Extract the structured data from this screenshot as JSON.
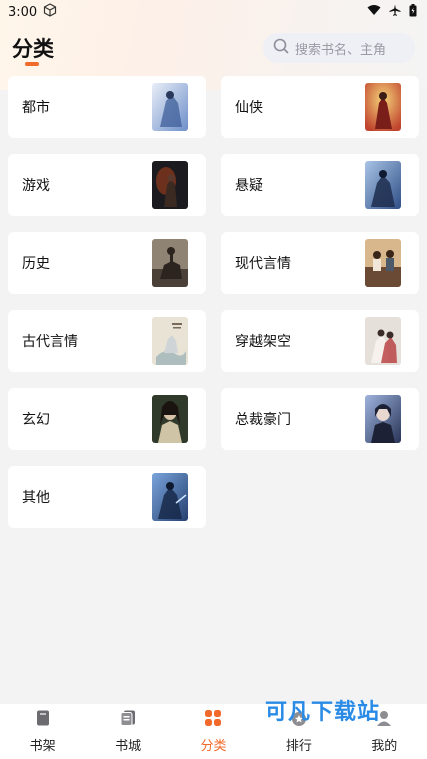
{
  "status_bar": {
    "time": "3:00"
  },
  "header": {
    "title": "分类",
    "search_placeholder": "搜索书名、主角"
  },
  "categories": [
    {
      "label": "都市",
      "thumb_colors": [
        "#6d8fc9",
        "#e9eef8"
      ]
    },
    {
      "label": "仙侠",
      "thumb_colors": [
        "#c0452e",
        "#e8b34a"
      ]
    },
    {
      "label": "游戏",
      "thumb_colors": [
        "#1b1b1f",
        "#b0421c"
      ]
    },
    {
      "label": "悬疑",
      "thumb_colors": [
        "#2f4f86",
        "#a9c4e6"
      ]
    },
    {
      "label": "历史",
      "thumb_colors": [
        "#4a4038",
        "#8f8373"
      ]
    },
    {
      "label": "现代言情",
      "thumb_colors": [
        "#6a4a34",
        "#d8b78d"
      ]
    },
    {
      "label": "古代言情",
      "thumb_colors": [
        "#e9e3d6",
        "#9fb3b8"
      ]
    },
    {
      "label": "穿越架空",
      "thumb_colors": [
        "#e6e0da",
        "#b63b3b"
      ]
    },
    {
      "label": "玄幻",
      "thumb_colors": [
        "#303a2a",
        "#cfc4a6"
      ]
    },
    {
      "label": "总裁豪门",
      "thumb_colors": [
        "#283457",
        "#9fb4de"
      ]
    },
    {
      "label": "其他",
      "thumb_colors": [
        "#25406f",
        "#7aa4dc"
      ]
    }
  ],
  "bottom_nav": [
    {
      "label": "书架",
      "icon": "bookshelf-icon",
      "active": false
    },
    {
      "label": "书城",
      "icon": "bookstore-icon",
      "active": false
    },
    {
      "label": "分类",
      "icon": "category-icon",
      "active": true
    },
    {
      "label": "排行",
      "icon": "ranking-icon",
      "active": false
    },
    {
      "label": "我的",
      "icon": "profile-icon",
      "active": false
    }
  ],
  "watermark": "可凡下载站",
  "colors": {
    "accent": "#f26a2a",
    "card": "#ffffff",
    "background": "#f3f3f3"
  }
}
